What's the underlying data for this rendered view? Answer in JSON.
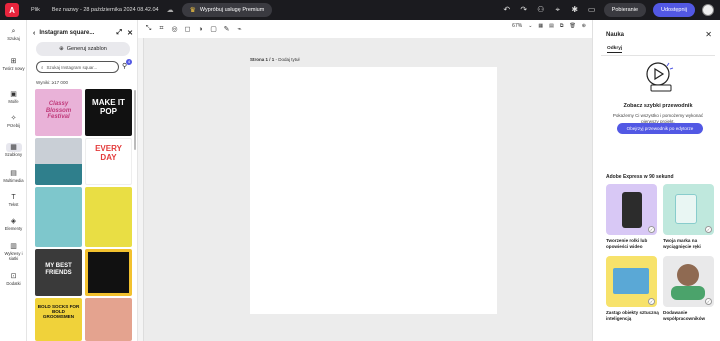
{
  "topbar": {
    "menu_label": "Plik",
    "doc_title": "Bez nazwy - 28 października 2024 08.42.04",
    "premium_label": "Wypróbuj usługę Premium",
    "download_label": "Pobieranie",
    "share_label": "Udostępnij"
  },
  "leftnav": {
    "items": [
      {
        "label": "Szukaj",
        "icon": "search-icon"
      },
      {
        "label": "Twórz nowy",
        "icon": "plus-doc-icon"
      },
      {
        "label": "Moife",
        "icon": "folder-icon"
      },
      {
        "label": "Przebij",
        "icon": "sparkle-icon"
      },
      {
        "label": "Szablony",
        "icon": "templates-icon"
      },
      {
        "label": "Multimedia",
        "icon": "media-icon"
      },
      {
        "label": "Tekst",
        "icon": "text-icon"
      },
      {
        "label": "Elementy",
        "icon": "shapes-icon"
      },
      {
        "label": "Wykresy i siatki",
        "icon": "grid-icon"
      },
      {
        "label": "Dodatki",
        "icon": "addons-icon"
      }
    ]
  },
  "panel": {
    "title": "Instagram square...",
    "generate_label": "Generuj szablon",
    "search_placeholder": "Szukaj Instagram squar...",
    "filter_count": "4",
    "results": "Wyniki: ≥17 000",
    "thumbs": [
      {
        "label": "Classy Blossom Festival",
        "color": "#e9b2d8",
        "text_color": "#c0397a"
      },
      {
        "label": "MAKE IT POP",
        "color": "#111111",
        "text_color": "#ffffff"
      },
      {
        "label": "",
        "color": "#c9cfd6",
        "text_color": "#333333"
      },
      {
        "label": "EVERY DAY",
        "color": "#ffffff",
        "text_color": "#e33a3a"
      },
      {
        "label": "",
        "color": "#57a3a8",
        "text_color": "#ffffff"
      },
      {
        "label": "",
        "color": "#eed64a",
        "text_color": "#333333"
      },
      {
        "label": "",
        "color": "#7ec7cc",
        "text_color": "#333333"
      },
      {
        "label": "",
        "color": "#e9de44",
        "text_color": "#333333"
      },
      {
        "label": "MY BEST FRIENDS",
        "color": "#3a3a3a",
        "text_color": "#ffffff"
      },
      {
        "label": "",
        "color": "#111111",
        "text_color": "#ffffff"
      },
      {
        "label": "BOLD SOCKS FOR BOLD GROOMSMEN",
        "color": "#f0d23a",
        "text_color": "#111111"
      },
      {
        "label": "",
        "color": "#e4a38f",
        "text_color": "#333333"
      }
    ]
  },
  "canvas": {
    "page_label_bold": "Strona 1 / 1",
    "page_label_rest": " - Dodaj tytuł",
    "zoom": "67%"
  },
  "learn": {
    "title": "Nauka",
    "tab": "Odkryj",
    "heading": "Zobacz szybki przewodnik",
    "description": "Pokażemy Ci wszystko i pomożemy wykonać pierwszy projekt.",
    "button": "Obejrzyj przewodnik po edytorze",
    "section": "Adobe Express w 90 sekund",
    "cards": [
      {
        "label": "Tworzenie rolki lub opowieści wideo",
        "color": "#d8c8f5"
      },
      {
        "label": "Twoja marka na wyciągnięcie ręki",
        "color": "#bfe8dd"
      },
      {
        "label": "Zastąp obiekty sztuczną inteligencją",
        "color": "#f7e26b"
      },
      {
        "label": "Dodawanie współpracowników",
        "color": "#e9e9ea"
      }
    ]
  }
}
